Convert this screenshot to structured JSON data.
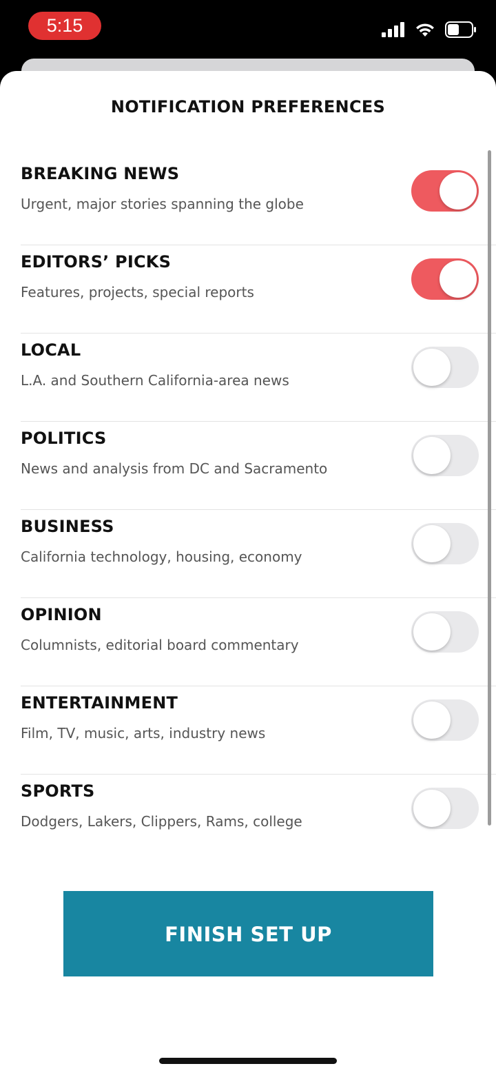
{
  "status_bar": {
    "time": "5:15",
    "icons": [
      "cellular-signal-icon",
      "wifi-icon",
      "battery-icon"
    ],
    "time_pill_color": "#e03131"
  },
  "sheet": {
    "title": "NOTIFICATION PREFERENCES",
    "items": [
      {
        "title": "BREAKING NEWS",
        "description": "Urgent, major stories spanning the globe",
        "enabled": true
      },
      {
        "title": "EDITORS’ PICKS",
        "description": "Features, projects, special reports",
        "enabled": true
      },
      {
        "title": "LOCAL",
        "description": "L.A. and Southern California-area news",
        "enabled": false
      },
      {
        "title": "POLITICS",
        "description": "News and analysis from DC and Sacramento",
        "enabled": false
      },
      {
        "title": "BUSINESS",
        "description": "California technology, housing, economy",
        "enabled": false
      },
      {
        "title": "OPINION",
        "description": "Columnists, editorial board commentary",
        "enabled": false
      },
      {
        "title": "ENTERTAINMENT",
        "description": "Film, TV, music, arts, industry news",
        "enabled": false
      },
      {
        "title": "SPORTS",
        "description": "Dodgers, Lakers, Clippers, Rams, college",
        "enabled": false
      }
    ],
    "finish_label": "FINISH SET UP"
  },
  "colors": {
    "toggle_on": "#ee5a5f",
    "toggle_off": "#e9e9eb",
    "button": "#1886a1"
  }
}
